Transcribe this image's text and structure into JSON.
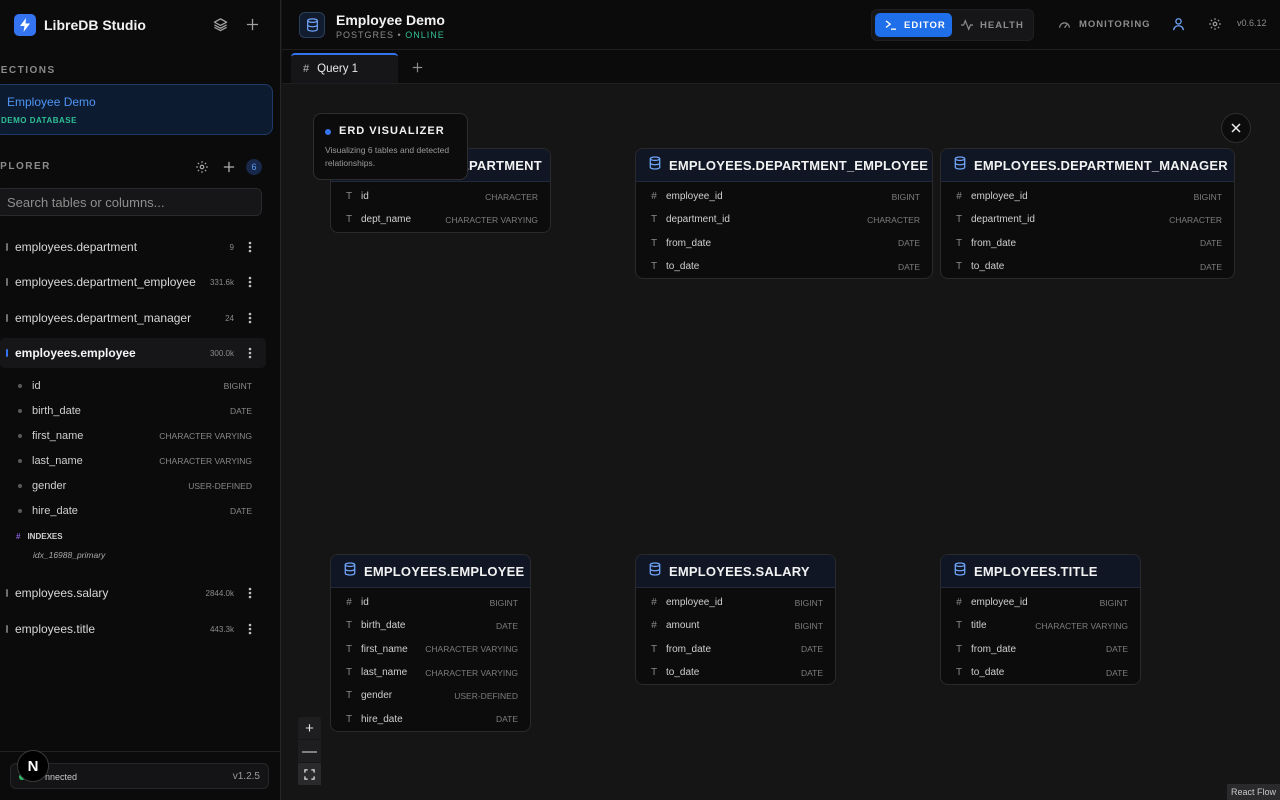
{
  "brand": {
    "name": "LibreDB Studio"
  },
  "sidebar": {
    "connections_label": "NECTIONS",
    "connection": {
      "name": "Employee Demo",
      "subtitle": "DEMO DATABASE"
    },
    "explorer_label": "XPLORER",
    "table_count": "6",
    "search_placeholder": "Search tables or columns...",
    "tables": [
      {
        "name": "employees.department",
        "count": "9"
      },
      {
        "name": "employees.department_employee",
        "count": "331.6k"
      },
      {
        "name": "employees.department_manager",
        "count": "24"
      },
      {
        "name": "employees.employee",
        "count": "300.0k"
      },
      {
        "name": "employees.salary",
        "count": "2844.0k"
      },
      {
        "name": "employees.title",
        "count": "443.3k"
      }
    ],
    "expanded_columns": [
      {
        "name": "id",
        "type": "BIGINT"
      },
      {
        "name": "birth_date",
        "type": "DATE"
      },
      {
        "name": "first_name",
        "type": "CHARACTER VARYING"
      },
      {
        "name": "last_name",
        "type": "CHARACTER VARYING"
      },
      {
        "name": "gender",
        "type": "USER-DEFINED"
      },
      {
        "name": "hire_date",
        "type": "DATE"
      }
    ],
    "indexes_label": "INDEXES",
    "index_name": "idx_16988_primary",
    "status": {
      "text": "nnected",
      "version": "v1.2.5"
    },
    "n_badge": "N"
  },
  "header": {
    "title": "Employee Demo",
    "engine": "POSTGRES",
    "separator": "•",
    "state": "ONLINE",
    "editor_label": "EDITOR",
    "health_label": "HEALTH",
    "monitoring_label": "MONITORING",
    "version": "v0.6.12"
  },
  "tabs": [
    {
      "label": "Query 1",
      "icon": "#"
    }
  ],
  "erd": {
    "tooltip": {
      "title": "ERD VISUALIZER",
      "description": "Visualizing 6 tables and detected relationships."
    },
    "nodes": [
      {
        "title": "EMPLOYEES.DEPARTMENT",
        "fields": [
          {
            "icon": "T",
            "name": "id",
            "type": "CHARACTER"
          },
          {
            "icon": "T",
            "name": "dept_name",
            "type": "CHARACTER VARYING"
          }
        ]
      },
      {
        "title": "EMPLOYEES.DEPARTMENT_EMPLOYEE",
        "fields": [
          {
            "icon": "#",
            "name": "employee_id",
            "type": "BIGINT"
          },
          {
            "icon": "T",
            "name": "department_id",
            "type": "CHARACTER"
          },
          {
            "icon": "T",
            "name": "from_date",
            "type": "DATE"
          },
          {
            "icon": "T",
            "name": "to_date",
            "type": "DATE"
          }
        ]
      },
      {
        "title": "EMPLOYEES.DEPARTMENT_MANAGER",
        "fields": [
          {
            "icon": "#",
            "name": "employee_id",
            "type": "BIGINT"
          },
          {
            "icon": "T",
            "name": "department_id",
            "type": "CHARACTER"
          },
          {
            "icon": "T",
            "name": "from_date",
            "type": "DATE"
          },
          {
            "icon": "T",
            "name": "to_date",
            "type": "DATE"
          }
        ]
      },
      {
        "title": "EMPLOYEES.EMPLOYEE",
        "fields": [
          {
            "icon": "#",
            "name": "id",
            "type": "BIGINT"
          },
          {
            "icon": "T",
            "name": "birth_date",
            "type": "DATE"
          },
          {
            "icon": "T",
            "name": "first_name",
            "type": "CHARACTER VARYING"
          },
          {
            "icon": "T",
            "name": "last_name",
            "type": "CHARACTER VARYING"
          },
          {
            "icon": "T",
            "name": "gender",
            "type": "USER-DEFINED"
          },
          {
            "icon": "T",
            "name": "hire_date",
            "type": "DATE"
          }
        ]
      },
      {
        "title": "EMPLOYEES.SALARY",
        "fields": [
          {
            "icon": "#",
            "name": "employee_id",
            "type": "BIGINT"
          },
          {
            "icon": "#",
            "name": "amount",
            "type": "BIGINT"
          },
          {
            "icon": "T",
            "name": "from_date",
            "type": "DATE"
          },
          {
            "icon": "T",
            "name": "to_date",
            "type": "DATE"
          }
        ]
      },
      {
        "title": "EMPLOYEES.TITLE",
        "fields": [
          {
            "icon": "#",
            "name": "employee_id",
            "type": "BIGINT"
          },
          {
            "icon": "T",
            "name": "title",
            "type": "CHARACTER VARYING"
          },
          {
            "icon": "T",
            "name": "from_date",
            "type": "DATE"
          },
          {
            "icon": "T",
            "name": "to_date",
            "type": "DATE"
          }
        ]
      }
    ],
    "zoom_in": "+",
    "zoom_out": "—",
    "attribution": "React Flow"
  },
  "colors": {
    "accent": "#3574f0",
    "online": "#2fbf94",
    "canvas": "#151515",
    "sidebar": "#0b0b0c"
  }
}
